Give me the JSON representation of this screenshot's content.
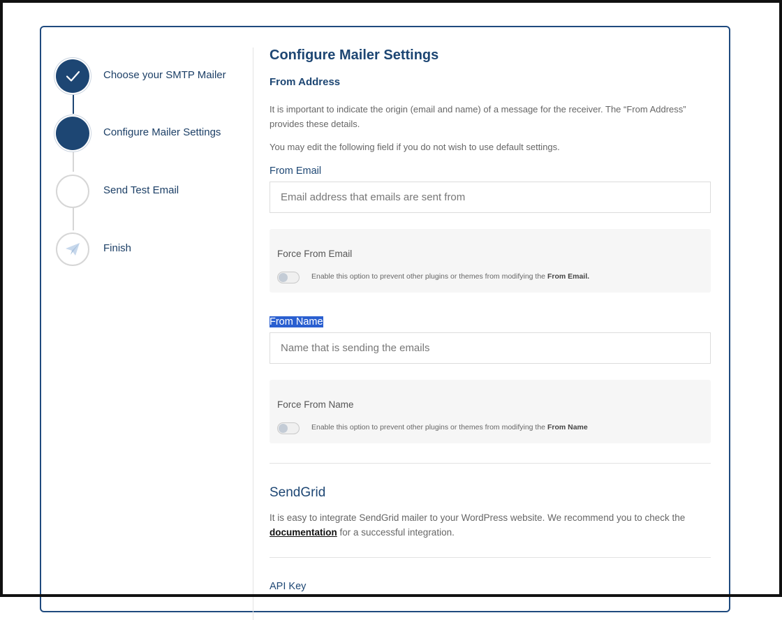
{
  "steps": [
    {
      "label": "Choose your SMTP Mailer",
      "state": "done",
      "icon": "check-icon"
    },
    {
      "label": "Configure Mailer Settings",
      "state": "active",
      "icon": ""
    },
    {
      "label": "Send Test Email",
      "state": "pending",
      "icon": ""
    },
    {
      "label": "Finish",
      "state": "pending",
      "icon": "paper-plane-icon"
    }
  ],
  "main": {
    "title": "Configure Mailer Settings",
    "from_address_heading": "From Address",
    "from_address_desc": "It is important to indicate the origin (email and name) of a message for the receiver. The “From Address” provides these details.",
    "edit_note": "You may edit the following field if you do not wish to use default settings.",
    "from_email": {
      "label": "From Email",
      "placeholder": "Email address that emails are sent from",
      "value": ""
    },
    "force_from_email": {
      "title": "Force From Email",
      "desc_prefix": "Enable this option to prevent other plugins or themes from modifying the ",
      "desc_bold": "From Email.",
      "enabled": false
    },
    "from_name": {
      "label": "From Name",
      "placeholder": "Name that is sending the emails",
      "value": ""
    },
    "force_from_name": {
      "title": "Force From Name",
      "desc_prefix": "Enable this option to prevent other plugins or themes from modifying the ",
      "desc_bold": "From Name",
      "enabled": false
    },
    "sendgrid": {
      "heading": "SendGrid",
      "desc_prefix": "It is easy to integrate SendGrid mailer to your WordPress website. We recommend you to check the ",
      "link_text": "documentation",
      "desc_suffix": " for a successful integration."
    },
    "api_key_label": "API Key"
  },
  "colors": {
    "accent": "#1d4673",
    "border": "#1f4a7e",
    "selection": "#2a5fd0"
  }
}
